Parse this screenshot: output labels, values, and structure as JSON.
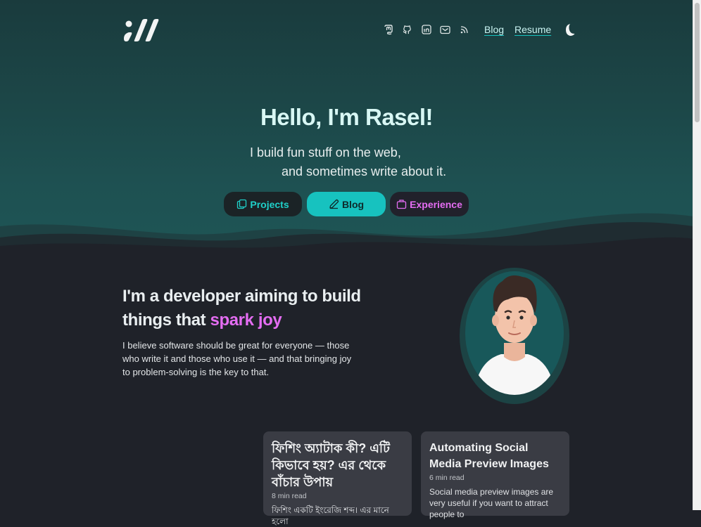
{
  "nav": {
    "icons": [
      "mastodon-icon",
      "github-icon",
      "linkedin-icon",
      "mail-icon",
      "rss-icon"
    ],
    "links": [
      "Blog",
      "Resume"
    ],
    "theme_icon": "moon-icon"
  },
  "hero": {
    "title": "Hello, I'm Rasel!",
    "tagline_line1": "I build fun stuff on the web,",
    "tagline_line2": "and sometimes write about it.",
    "buttons": {
      "projects": "Projects",
      "blog": "Blog",
      "experience": "Experience"
    }
  },
  "intro": {
    "title_part1": "I'm a developer aiming to build",
    "title_part2": "things that",
    "title_highlight": "spark joy",
    "text": "I believe software should be great for everyone — those who write it and those who use it — and that bringing joy to problem-solving is the key to that."
  },
  "posts": [
    {
      "title": "ফিশিং অ্যাটাক কী? এটি কিভাবে হয়? এর থেকে বাঁচার উপায়",
      "meta": "8 min read",
      "excerpt": "ফিশিং একটি ইংরেজি শব্দ। এর মানে হলো"
    },
    {
      "title": "Automating Social Media Preview Images",
      "meta": "6 min read",
      "excerpt": "Social media preview images are very useful if you want to attract people to"
    }
  ],
  "colors": {
    "accent_teal": "#17c2bf",
    "accent_pink": "#e46df2",
    "background": "#1f2229",
    "card": "#3a3c44"
  }
}
